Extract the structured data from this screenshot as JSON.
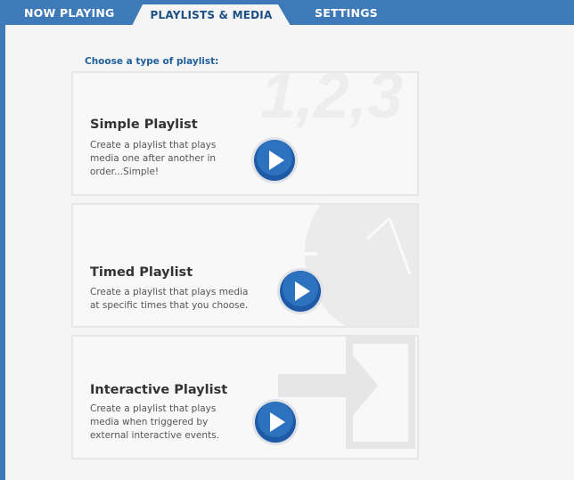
{
  "tabs": {
    "now_playing": "NOW PLAYING",
    "playlists_media": "PLAYLISTS & MEDIA",
    "settings": "SETTINGS"
  },
  "heading": "Choose a type of playlist:",
  "cards": [
    {
      "title": "Simple Playlist",
      "description": "Create a playlist that plays\nmedia one after another in\norder...Simple!",
      "watermark_text": "1,2,3",
      "watermark": "numbers-1-2-3"
    },
    {
      "title": "Timed Playlist",
      "description": "Create a playlist that plays media\nat specific times that you choose.",
      "watermark": "clock-face"
    },
    {
      "title": "Interactive Playlist",
      "description": "Create a playlist that plays\nmedia when triggered by\nexternal interactive events.",
      "watermark": "arrow-into-box"
    }
  ],
  "colors": {
    "tab_bar": "#3f7ab8",
    "active_tab_text": "#1c4f86",
    "heading": "#1f5f99",
    "play_button": "#1e5aa6"
  }
}
